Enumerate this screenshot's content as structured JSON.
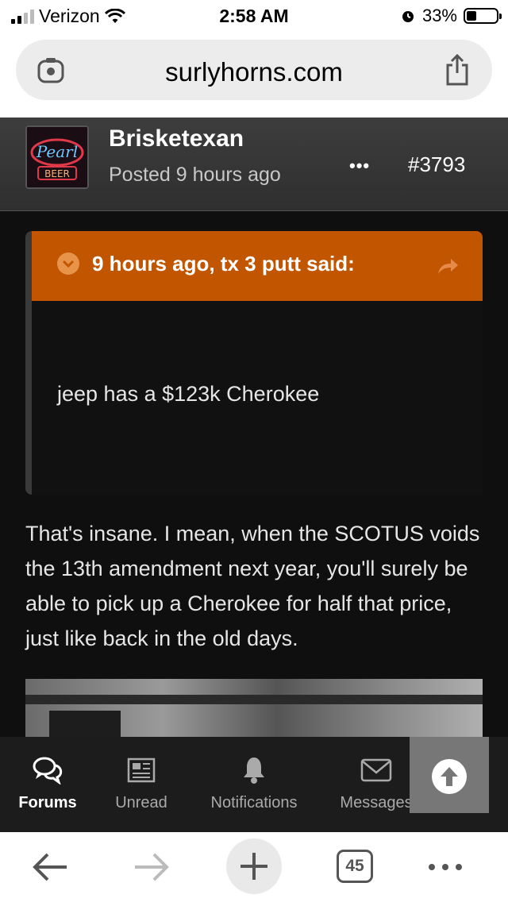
{
  "status_bar": {
    "carrier": "Verizon",
    "time": "2:58 AM",
    "battery_percent": "33%",
    "battery_level": 0.33
  },
  "browser": {
    "url": "surlyhorns.com"
  },
  "post": {
    "author": "Brisketexan",
    "posted": "Posted 9 hours ago",
    "more_label": "•••",
    "post_number": "#3793",
    "avatar_text_1": "Pearl",
    "avatar_text_2": "BEER",
    "quote": {
      "title": "9 hours ago, tx 3 putt said:",
      "body": "jeep has a $123k Cherokee"
    },
    "body": "That's insane.  I mean, when the SCOTUS voids the 13th amendment next year, you'll surely be able to pick up a Cherokee for half that price, just like back in the old days."
  },
  "forum_tabs": [
    {
      "label": "Forums",
      "icon": "forums-icon"
    },
    {
      "label": "Unread",
      "icon": "unread-icon"
    },
    {
      "label": "Notifications",
      "icon": "bell-icon"
    },
    {
      "label": "Messages",
      "icon": "envelope-icon"
    }
  ],
  "safari": {
    "tab_count": "45"
  },
  "colors": {
    "quote_accent": "#c25500",
    "background": "#0f0f0f"
  }
}
